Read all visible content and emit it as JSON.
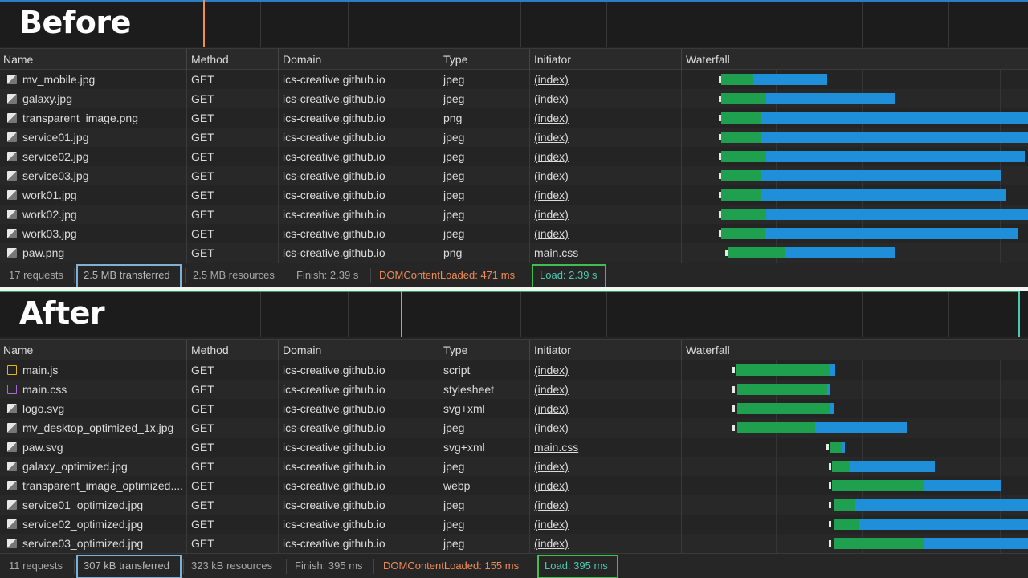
{
  "columns": [
    "Name",
    "Method",
    "Domain",
    "Type",
    "Initiator",
    "Waterfall"
  ],
  "before": {
    "label": "Before",
    "rows": [
      {
        "name": "mv_mobile.jpg",
        "method": "GET",
        "domain": "ics-creative.github.io",
        "type": "jpeg",
        "initiator": "(index)",
        "icon": "image-icon"
      },
      {
        "name": "galaxy.jpg",
        "method": "GET",
        "domain": "ics-creative.github.io",
        "type": "jpeg",
        "initiator": "(index)",
        "icon": "image-icon"
      },
      {
        "name": "transparent_image.png",
        "method": "GET",
        "domain": "ics-creative.github.io",
        "type": "png",
        "initiator": "(index)",
        "icon": "image-icon"
      },
      {
        "name": "service01.jpg",
        "method": "GET",
        "domain": "ics-creative.github.io",
        "type": "jpeg",
        "initiator": "(index)",
        "icon": "image-icon"
      },
      {
        "name": "service02.jpg",
        "method": "GET",
        "domain": "ics-creative.github.io",
        "type": "jpeg",
        "initiator": "(index)",
        "icon": "image-icon"
      },
      {
        "name": "service03.jpg",
        "method": "GET",
        "domain": "ics-creative.github.io",
        "type": "jpeg",
        "initiator": "(index)",
        "icon": "image-icon"
      },
      {
        "name": "work01.jpg",
        "method": "GET",
        "domain": "ics-creative.github.io",
        "type": "jpeg",
        "initiator": "(index)",
        "icon": "image-icon"
      },
      {
        "name": "work02.jpg",
        "method": "GET",
        "domain": "ics-creative.github.io",
        "type": "jpeg",
        "initiator": "(index)",
        "icon": "image-icon"
      },
      {
        "name": "work03.jpg",
        "method": "GET",
        "domain": "ics-creative.github.io",
        "type": "jpeg",
        "initiator": "(index)",
        "icon": "image-icon"
      },
      {
        "name": "paw.png",
        "method": "GET",
        "domain": "ics-creative.github.io",
        "type": "png",
        "initiator": "main.css",
        "icon": "image-icon"
      }
    ],
    "status": {
      "requests": "17 requests",
      "transferred": "2.5 MB transferred",
      "resources": "2.5 MB resources",
      "finish": "Finish: 2.39 s",
      "dom": "DOMContentLoaded: 471 ms",
      "load": "Load: 2.39 s"
    }
  },
  "after": {
    "label": "After",
    "rows": [
      {
        "name": "main.js",
        "method": "GET",
        "domain": "ics-creative.github.io",
        "type": "script",
        "initiator": "(index)",
        "icon": "script-icon"
      },
      {
        "name": "main.css",
        "method": "GET",
        "domain": "ics-creative.github.io",
        "type": "stylesheet",
        "initiator": "(index)",
        "icon": "stylesheet-icon"
      },
      {
        "name": "logo.svg",
        "method": "GET",
        "domain": "ics-creative.github.io",
        "type": "svg+xml",
        "initiator": "(index)",
        "icon": "image-icon"
      },
      {
        "name": "mv_desktop_optimized_1x.jpg",
        "method": "GET",
        "domain": "ics-creative.github.io",
        "type": "jpeg",
        "initiator": "(index)",
        "icon": "image-icon"
      },
      {
        "name": "paw.svg",
        "method": "GET",
        "domain": "ics-creative.github.io",
        "type": "svg+xml",
        "initiator": "main.css",
        "icon": "image-icon"
      },
      {
        "name": "galaxy_optimized.jpg",
        "method": "GET",
        "domain": "ics-creative.github.io",
        "type": "jpeg",
        "initiator": "(index)",
        "icon": "image-icon"
      },
      {
        "name": "transparent_image_optimized....",
        "method": "GET",
        "domain": "ics-creative.github.io",
        "type": "webp",
        "initiator": "(index)",
        "icon": "image-icon"
      },
      {
        "name": "service01_optimized.jpg",
        "method": "GET",
        "domain": "ics-creative.github.io",
        "type": "jpeg",
        "initiator": "(index)",
        "icon": "image-icon"
      },
      {
        "name": "service02_optimized.jpg",
        "method": "GET",
        "domain": "ics-creative.github.io",
        "type": "jpeg",
        "initiator": "(index)",
        "icon": "image-icon"
      },
      {
        "name": "service03_optimized.jpg",
        "method": "GET",
        "domain": "ics-creative.github.io",
        "type": "jpeg",
        "initiator": "(index)",
        "icon": "image-icon"
      }
    ],
    "status": {
      "requests": "11 requests",
      "transferred": "307 kB transferred",
      "resources": "323 kB resources",
      "finish": "Finish: 395 ms",
      "dom": "DOMContentLoaded: 155 ms",
      "load": "Load: 395 ms"
    }
  },
  "colors": {
    "dom": "#f28b54",
    "load": "#4ec9b0",
    "transferred_box": "#7fb0d8",
    "load_box": "#3fbf4f",
    "waiting": "#1fa04f",
    "download": "#1e8fd8"
  }
}
